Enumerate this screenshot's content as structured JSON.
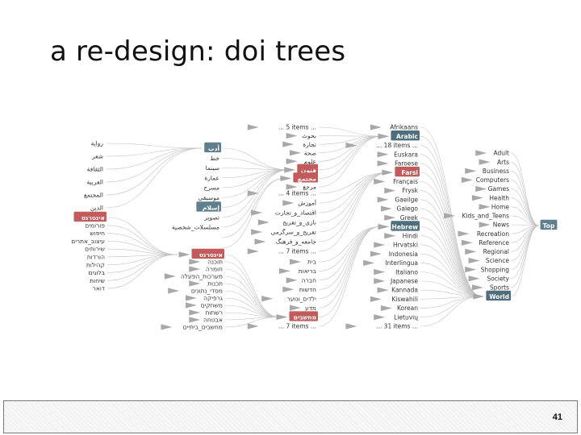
{
  "title": "a re-design: doi trees",
  "page_number": "41",
  "root": "Top",
  "top_level": [
    "Adult",
    "Arts",
    "Business",
    "Computers",
    "Games",
    "Health",
    "Home",
    "Kids_and_Teens",
    "News",
    "Recreation",
    "Reference",
    "Regional",
    "Science",
    "Shopping",
    "Society",
    "Sports",
    "World"
  ],
  "world_children": [
    "Afrikaans",
    "Arabic",
    "... 18 items ...",
    "Euskara",
    "Faroese",
    "Farsi",
    "Français",
    "Frysk",
    "Gaeilge",
    "Galego",
    "Greek",
    "Hebrew",
    "Hindi",
    "Hrvatski",
    "Indonesia",
    "Interlingua",
    "Italiano",
    "Japanese",
    "Kannada",
    "Kiswahili",
    "Korean",
    "Lietuvių",
    "... 31 items ..."
  ],
  "highlighted": [
    "Top",
    "World",
    "Arabic",
    "Farsi",
    "Hebrew",
    "أدب",
    "فنون",
    "مجتمع",
    "إسلام",
    "אינטרנט",
    "מחשבים"
  ],
  "arabic_children": [
    "... 5 items ...",
    "بحوث",
    "تجارة",
    "صحة",
    "علوم",
    "فنون",
    "مجتمع",
    "مرجع"
  ],
  "farsi_children": [
    "... 4 items ...",
    "آموزش",
    "اقتصاد_و_تجارت",
    "بازی_و_تفریح",
    "تفریح_و_سرگرمی",
    "جامعه_و_فرهنگ",
    "... 7 items ..."
  ],
  "hebrew_children": [
    "בית",
    "בריאות",
    "חברה",
    "חדשות",
    "ילדים_ונוער",
    "מדע",
    "מחשבים",
    "... 7 items ..."
  ],
  "funun_children": [
    "أدب",
    "خط",
    "سينما",
    "عمارة",
    "مسرح",
    "موسيقى",
    "إسلام",
    "تصوير",
    "مسلسلات_شخصية"
  ],
  "adab_children": [
    "رواية",
    "شعر",
    "الثقافة",
    "العربية",
    "المجتمع",
    "الدين"
  ],
  "mujtama_children": [
    "إسلام",
    "شخصيات"
  ],
  "internet_children": [
    "אינטרנט",
    "תוכנה",
    "חומרה",
    "מערכות_הפעלה",
    "תכנות",
    "מסדי_נתונים",
    "גרפיקה",
    "משחקים",
    "רשתות",
    "אבטחה",
    "מחשבים_ביתיים"
  ],
  "internet_grandchildren": [
    "אינטרנט",
    "פורומים",
    "חיפוש",
    "עיצוב_אתרים",
    "שירותים",
    "הורדות",
    "קהילות",
    "בלוגים",
    "שיחות",
    "דואר"
  ]
}
